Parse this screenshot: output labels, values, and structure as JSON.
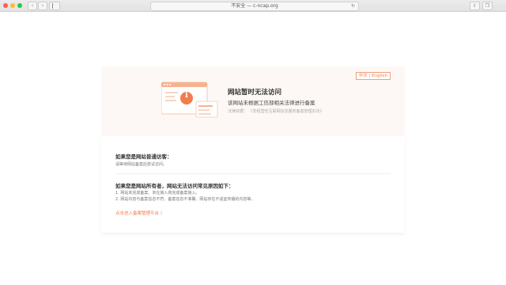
{
  "browser": {
    "address": "不安全 — c-ncap.org",
    "back_glyph": "‹",
    "forward_glyph": "›",
    "reload_glyph": "↻",
    "share_glyph": "⇧",
    "tabs_glyph": "❐"
  },
  "notice": {
    "lang_zh": "中文",
    "lang_sep": " | ",
    "lang_en": "English",
    "title": "网站暂时无法访问",
    "subtitle": "该网站未根据工信部相关法律进行备案",
    "law_label": "法律依据：",
    "law_text": "《非经营性互联网信息服务备案管理办法》",
    "icon_glyph": "i"
  },
  "visitor": {
    "heading": "如果您是网站普通访客：",
    "text": "请等待网站备案后尝试访问。"
  },
  "owner": {
    "heading": "如果您是网站所有者，网站无法访问常见原因如下：",
    "reasons": [
      "1. 网站未完成备案、未在接入商完成备案接入。",
      "2. 网站内容与备案信息不符、备案信息不准确、网站存在不适宜传播的内容等。"
    ],
    "link": "点击进入备案管理平台 〉"
  },
  "colors": {
    "accent": "#f07d4b",
    "hero_bg": "#fdf8f5"
  }
}
